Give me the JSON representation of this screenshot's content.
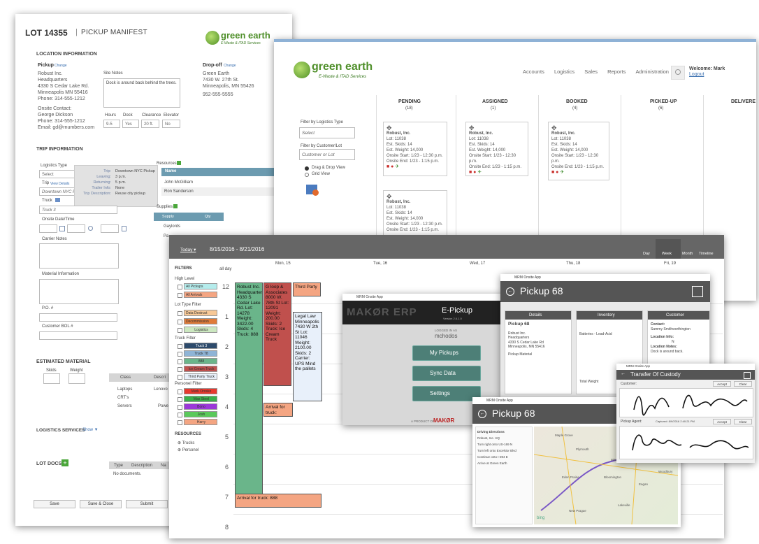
{
  "manifest": {
    "lot": "LOT 14355",
    "sep": "|",
    "title": "PICKUP MANIFEST",
    "logo_name": "green earth",
    "logo_sub": "E-Waste & ITAD Services",
    "location_info": "LOCATION INFORMATION",
    "pickup_label": "Pickup",
    "change": "Change",
    "pickup_address": [
      "Robust Inc.",
      "Headquarters",
      "4330 S Cedar Lake Rd.",
      "Minneapolis MN 55416",
      "Phone: 314-555-1212"
    ],
    "onsite_contact": [
      "Onsite Contact:",
      "George Dickson",
      "Phone: 314-555-1212",
      "Email: gd@rnumbers.com"
    ],
    "site_notes_label": "Site Notes",
    "site_notes": "Dock is around back behind the trees.",
    "hours_label": "Hours",
    "hours_val": "9-5",
    "dock_label": "Dock",
    "dock_val": "Yes",
    "clearance_label": "Clearance",
    "clearance_val": "20 ft.",
    "elevator_label": "Elevator",
    "elevator_val": "No",
    "dropoff_label": "Drop-off",
    "dropoff_address": [
      "Green Earth",
      "7430 W. 27th St.",
      "Minneapolis, MN 55426",
      "952-555-5555"
    ],
    "trip_info": "TRIP INFORMATION",
    "logistics_type": "Logistics Type",
    "select": "Select",
    "trip": "Trip",
    "view_details": "View Details",
    "trip_val": "Downtown NYC Pi",
    "tooltip_keys": [
      "Trip:",
      "Leaving:",
      "Returning:",
      "Trailer Info:",
      "Trip Description:"
    ],
    "tooltip_vals": [
      "Downtown NYC Pickup",
      "3 p.m.",
      "5 p.m.",
      "None",
      "Reuse city pickup"
    ],
    "truck": "Truck",
    "truck_val": "Truck 3",
    "onsite_datetime": "Onsite Date/Time",
    "carrier_notes": "Carrier Notes",
    "material_info": "Material Information",
    "po": "P.O. #",
    "customer_bol": "Customer BOL #",
    "resources": "Resources",
    "res_header": "Name",
    "res_rows": [
      "John McGilliam",
      "Ron Sanderson"
    ],
    "supplies": "Supplies",
    "sup_headers": [
      "Supply",
      "Qty"
    ],
    "sup_rows": [
      "Gaylords",
      "Pa"
    ],
    "estimated_material": "ESTIMATED MATERIAL",
    "skids": "Skids",
    "weight": "Weight",
    "class_headers": [
      "Class",
      "Descri"
    ],
    "class_rows": [
      [
        "Laptops",
        "Lenovo"
      ],
      [
        "CRT's",
        ""
      ],
      [
        "Servers",
        "Powe"
      ]
    ],
    "logistics_services": "LOGISTICS SERVICES",
    "show": "Show ▼",
    "lot_docs": "LOT DOCS",
    "doc_headers": [
      "Type",
      "Description",
      "Na"
    ],
    "no_docs": "No documents.",
    "buttons": [
      "Save",
      "Save & Close",
      "Submit"
    ]
  },
  "dashboard": {
    "nav": [
      "Accounts",
      "Logistics",
      "Sales",
      "Reports",
      "Administration"
    ],
    "welcome": "Welcome: Mark",
    "logout": "Logout",
    "filter_type_label": "Filter by Logistics Type",
    "filter_type_val": "Select",
    "filter_customer_label": "Filter by Customer/Lot",
    "filter_customer_ph": "Customer or Lot",
    "view_dd": "Drag & Drop View",
    "view_grid": "Grid View",
    "columns": [
      {
        "title": "PENDING",
        "count": "(18)"
      },
      {
        "title": "ASSIGNED",
        "count": "(1)"
      },
      {
        "title": "BOOKED",
        "count": "(4)"
      },
      {
        "title": "PICKED-UP",
        "count": "(6)"
      },
      {
        "title": "DELIVERE",
        "count": ""
      }
    ],
    "card_lines": [
      "Robust, Inc.",
      "Lot: 11038",
      "Est. Skids: 14",
      "Est. Weight: 14,000",
      "Onsite Start: 1/23 - 12:30 p.m.",
      "Onsite End: 1/23 - 1:15 p.m."
    ]
  },
  "calendar": {
    "today": "Today ▾",
    "range": "8/15/2016 - 8/21/2016",
    "views": [
      "Day",
      "Week",
      "Month",
      "Timeline"
    ],
    "days": [
      "Mon, 15",
      "Tue, 16",
      "Wed, 17",
      "Thu, 18",
      "Fri, 19"
    ],
    "all_day": "all day",
    "hours": [
      "12",
      "1",
      "2",
      "3",
      "4",
      "5",
      "6",
      "7",
      "8"
    ],
    "filters": "FILTERS",
    "high_level": "High Level",
    "high_items": [
      "All Pickups",
      "All Arrivals"
    ],
    "lot_type_filter": "Lot Type Filter",
    "lot_items": [
      "Data Destruct",
      "Decommission",
      "Logistics"
    ],
    "truck_filter": "Truck Filter",
    "truck_items": [
      "Truck 3",
      "Truck 78",
      "888",
      "Ice Cream Truck",
      "Third Party Truck"
    ],
    "personel_filter": "Personel Filter",
    "person_items": [
      "Mark Orosko",
      "Max Steel",
      "Bono",
      "Josh",
      "Harry"
    ],
    "resources": "RESOURCES",
    "res_items": [
      "Trucks",
      "Personel"
    ],
    "events": {
      "robust": "Robust Inc. Headquarters 4330 S Cedar Lake Rd. Lot: 14278 Weight: 3422.00 Skids: 4 Truck: 888",
      "gloop": "G loop & Associates 8000 W. 78th St Lot: 12091 Weight: 200.00 Skids: 2 Truck: Ice Cream Truck",
      "third": "Third Party",
      "legal": "Legal Law Minneapolis 7430 W 2th St Lot: 11046 Weight: 2100.00 Skids: 2 Carrier: UPS Mind the pallets",
      "arrival_truck": "Arrival for truck:",
      "arrival_888": "Arrival for truck: 888"
    }
  },
  "tablet": {
    "title": "MRM Onsite App",
    "brand": "MAKØR ERP",
    "app": "E-Pickup",
    "version": "Version 2.6.1.0",
    "logged_in_as": "LOGGED IN AS",
    "user": "mchodos",
    "buttons": [
      "My Pickups",
      "Sync Data",
      "Settings"
    ],
    "product_of": "A PRODUCT OF",
    "maker": "MAKØR"
  },
  "pickup_window": {
    "title": "MRM Onsite App",
    "heading": "Pickup 68",
    "panels": [
      "Details",
      "Inventory",
      "Customer"
    ],
    "details_head": "Pickup 68",
    "details_lines": [
      "Robust Inc.",
      "Headquarters",
      "4330 S Cedar Lake Rd",
      "Minneapolis, MN 55416",
      "Pickup Material"
    ],
    "inv_line": "Batteries - Lead-Acid",
    "cust_lines": [
      "Contact:",
      "Sammy Smithworthington",
      "Location Info:",
      "N",
      "Location Notes:",
      "Dock is around back."
    ],
    "total_weight": "Total Weight"
  },
  "map_window": {
    "title": "MRM Onsite App",
    "heading": "Pickup 68",
    "dirs_title": "Driving Directions",
    "dirs": [
      "Robust, Inc. HQ",
      "Turn right onto US-169 N",
      "Turn left onto Excelsior Blvd",
      "Continue onto I-394 E",
      "Arrive at Green Earth"
    ],
    "bing": "bing",
    "places": [
      "Maple Grove",
      "Plymouth",
      "Minneapolis",
      "St Paul",
      "Bloomington",
      "Eagan",
      "Lakeville",
      "Eden Prairie",
      "Woodbury",
      "New Prague"
    ]
  },
  "custody": {
    "title": "MRM Onsite App",
    "heading": "Transfer Of Custody",
    "customer": "Customer:",
    "agent": "Pickup Agent:",
    "captured": "Captured: 8/9/2016 2:40:21 PM",
    "accept": "Accept",
    "clear": "Clear"
  }
}
